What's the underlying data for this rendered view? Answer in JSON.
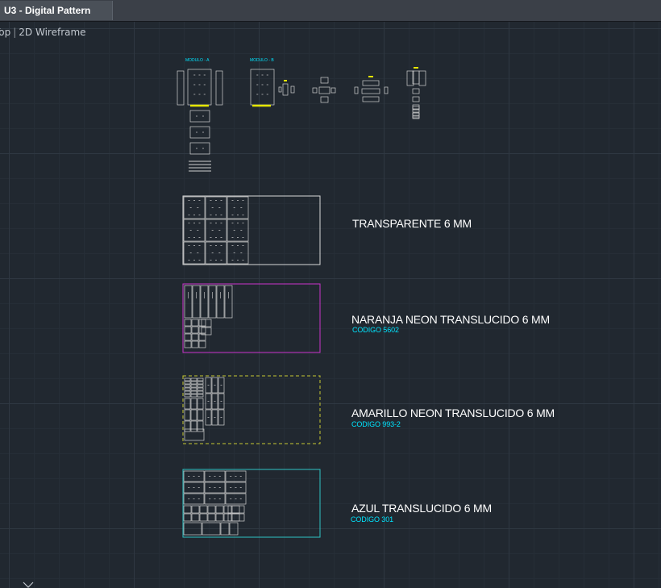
{
  "window": {
    "tab_title": "U3 - Digital Pattern"
  },
  "viewport": {
    "view_name": "Top",
    "visual_style": "2D Wireframe"
  },
  "modules": [
    {
      "label": "MODULO - A"
    },
    {
      "label": "MODULO - B"
    }
  ],
  "sheets": [
    {
      "title": "TRANSPARENTE 6 MM",
      "code": "",
      "color": "#d8d8d8",
      "style": "solid"
    },
    {
      "title": "NARANJA NEON TRANSLUCIDO 6 MM",
      "code": "CODIGO 5602",
      "color": "#cc33cc",
      "style": "solid"
    },
    {
      "title": "AMARILLO NEON TRANSLUCIDO 6 MM",
      "code": "CODIGO 993-2",
      "color": "#c8c832",
      "style": "dashed"
    },
    {
      "title": "AZUL TRANSLUCIDO 6 MM",
      "code": "CODIGO 301",
      "color": "#2ec4c4",
      "style": "solid"
    }
  ],
  "colors": {
    "background": "#212830",
    "grid_major": "#2f3842",
    "grid_minor": "#262e37",
    "linework": "#d0d0d0",
    "cyan_text": "#00e5ff",
    "highlight_yellow": "#e6e600"
  },
  "icons": {
    "ucs": "ucs-axis-icon"
  }
}
